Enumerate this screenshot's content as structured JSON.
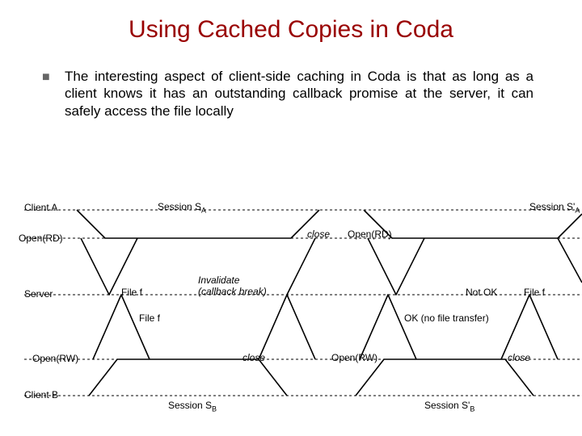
{
  "title": "Using Cached Copies in Coda",
  "body": "The interesting aspect of client-side caching in Coda is that as long as a client knows it has an outstanding callback promise at the server, it can safely access the file locally",
  "rows": {
    "client_a": "Client A",
    "open_rd_row": "Open(RD)",
    "server": "Server",
    "open_rw_row": "Open(RW)",
    "client_b": "Client B"
  },
  "labels": {
    "session_sa": "Session S",
    "session_sa_sub": "A",
    "session_sa2": "Session S'",
    "session_sa2_sub": "A",
    "session_sb": "Session S",
    "session_sb_sub": "B",
    "session_sb2": "Session S'",
    "session_sb2_sub": "B",
    "open_rd": "Open(RD)",
    "open_rw": "Open(RW)",
    "close": "close",
    "file_f": "File f",
    "invalidate_l1": "Invalidate",
    "invalidate_l2": "(callback break)",
    "not_ok": "Not OK",
    "ok_no_transfer": "OK (no file transfer)"
  }
}
